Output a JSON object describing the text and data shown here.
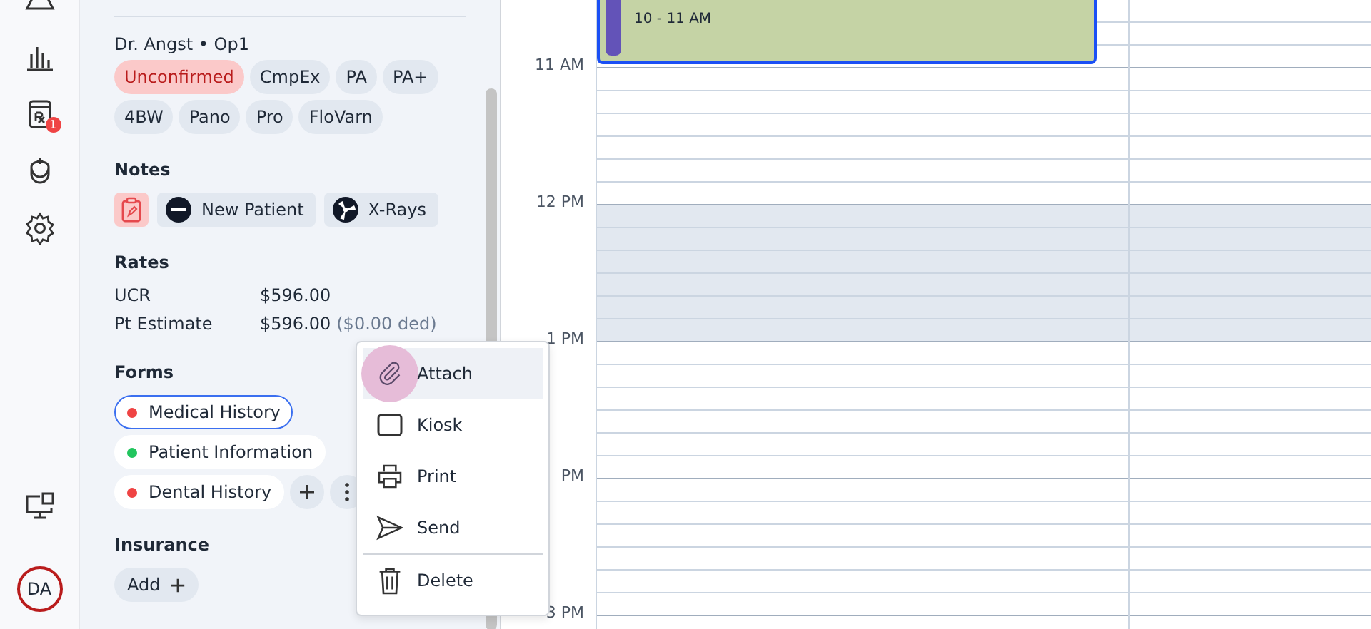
{
  "rail": {
    "badge": "1",
    "avatar": "DA"
  },
  "details": {
    "provider": "Dr. Angst • Op1",
    "tags": [
      {
        "label": "Unconfirmed",
        "kind": "status"
      },
      {
        "label": "CmpEx",
        "kind": "plain"
      },
      {
        "label": "PA",
        "kind": "plain"
      },
      {
        "label": "PA+",
        "kind": "plain"
      },
      {
        "label": "4BW",
        "kind": "plain"
      },
      {
        "label": "Pano",
        "kind": "plain"
      },
      {
        "label": "Pro",
        "kind": "plain"
      },
      {
        "label": "FloVarn",
        "kind": "plain"
      }
    ],
    "notes": {
      "title": "Notes",
      "chips": [
        {
          "kind": "clipboard"
        },
        {
          "kind": "new",
          "label": "New Patient"
        },
        {
          "kind": "xray",
          "label": "X-Rays"
        }
      ]
    },
    "rates": {
      "title": "Rates",
      "rows": [
        {
          "label": "UCR",
          "value": "$596.00"
        },
        {
          "label": "Pt Estimate",
          "value": "$596.00",
          "note": "($0.00 ded)"
        }
      ]
    },
    "forms": {
      "title": "Forms",
      "items": [
        {
          "label": "Medical History",
          "color": "#ef4444",
          "selected": true
        },
        {
          "label": "Patient Information",
          "color": "#22c55e",
          "selected": false
        },
        {
          "label": "Dental History",
          "color": "#ef4444",
          "selected": false
        }
      ]
    },
    "insurance": {
      "title": "Insurance",
      "add_label": "Add"
    }
  },
  "menu": {
    "items": [
      {
        "label": "Attach",
        "kind": "attach",
        "selected": true,
        "divider_before": false
      },
      {
        "label": "Kiosk",
        "kind": "kiosk",
        "selected": false,
        "divider_before": false
      },
      {
        "label": "Print",
        "kind": "print",
        "selected": false,
        "divider_before": false
      },
      {
        "label": "Send",
        "kind": "send",
        "selected": false,
        "divider_before": false
      },
      {
        "label": "Delete",
        "kind": "delete",
        "selected": false,
        "divider_before": true
      }
    ]
  },
  "calendar": {
    "time_labels": [
      "11 AM",
      "12 PM",
      "1 PM",
      "PM",
      "3 PM"
    ],
    "appointment": {
      "time": "10 - 11 AM"
    }
  }
}
